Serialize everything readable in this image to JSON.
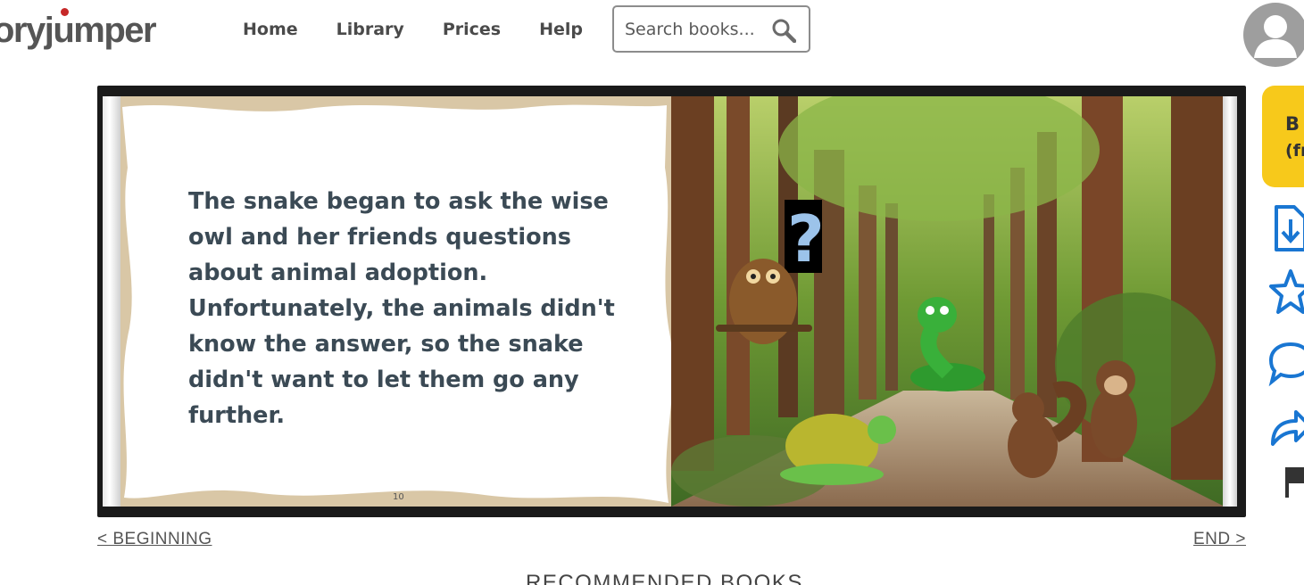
{
  "header": {
    "logo_text": "oryjumper",
    "nav": [
      "Home",
      "Library",
      "Prices",
      "Help"
    ],
    "search_placeholder": "Search books..."
  },
  "book": {
    "left_page_text": "The snake began to ask the wise owl and her friends questions about animal adoption. Unfortunately, the animals didn't know the answer, so the snake didn't want to let them go any further.",
    "page_number": "10"
  },
  "navigation": {
    "beginning": "< BEGINNING",
    "end": "END >"
  },
  "section_heading": "RECOMMENDED BOOKS",
  "side_panel": {
    "read_button_line1": "B",
    "read_button_line2": "(fr"
  },
  "colors": {
    "accent_yellow": "#f7c91b",
    "icon_blue": "#1976d2",
    "text_slate": "#3b4a55"
  }
}
